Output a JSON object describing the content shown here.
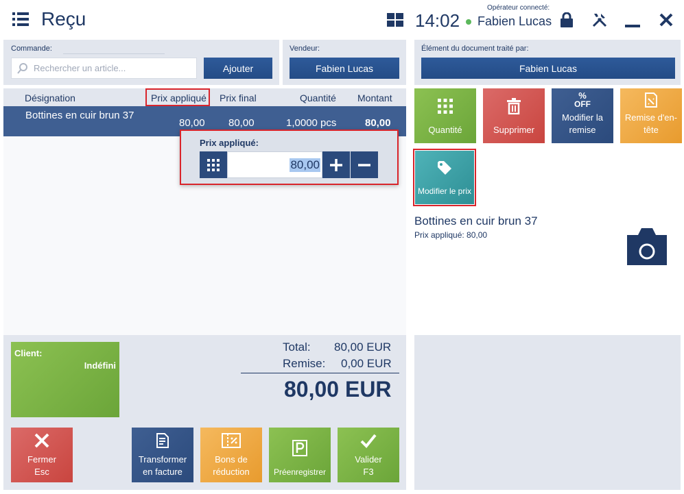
{
  "header": {
    "title": "Reçu",
    "time": "14:02",
    "operator_label": "Opérateur connecté:",
    "operator_name": "Fabien Lucas"
  },
  "order": {
    "label": "Commande:",
    "search_placeholder": "Rechercher un article...",
    "add_button": "Ajouter"
  },
  "seller": {
    "label": "Vendeur:",
    "name": "Fabien Lucas"
  },
  "processed_by": {
    "label": "Élément du document traité par:",
    "name": "Fabien Lucas"
  },
  "table": {
    "headers": [
      "Désignation",
      "Prix appliqué",
      "Prix final",
      "Quantité",
      "Montant"
    ],
    "rows": [
      {
        "designation": "Bottines en cuir brun 37",
        "applied_price": "80,00",
        "final_price": "80,00",
        "quantity": "1,0000 pcs",
        "amount": "80,00"
      }
    ]
  },
  "price_popup": {
    "label": "Prix appliqué:",
    "value": "80,00"
  },
  "tiles": {
    "quantity": "Quantité",
    "delete": "Supprimer",
    "edit_discount": "Modifier la remise",
    "off_text": "OFF",
    "header_discount": "Remise d'en-tête",
    "edit_price": "Modifier le prix"
  },
  "item_info": {
    "name": "Bottines en cuir brun 37",
    "price_line": "Prix appliqué: 80,00"
  },
  "client": {
    "label": "Client:",
    "value": "Indéfini"
  },
  "totals": {
    "total_label": "Total:",
    "total_value": "80,00 EUR",
    "discount_label": "Remise:",
    "discount_value": "0,00 EUR",
    "grand_total": "80,00 EUR"
  },
  "actions": {
    "close": "Fermer",
    "close_key": "Esc",
    "invoice_1": "Transformer",
    "invoice_2": "en facture",
    "vouchers_1": "Bons de",
    "vouchers_2": "réduction",
    "preregister": "Préenregistrer",
    "validate": "Valider",
    "validate_key": "F3"
  },
  "colors": {
    "navy": "#1f3864",
    "row_blue": "#3f5f92",
    "panel": "#e2e6ee",
    "green": "#8cc152",
    "red": "#db6a68",
    "orange": "#f5b95e",
    "teal": "#4fb3b8",
    "highlight_red": "#d9242b"
  }
}
